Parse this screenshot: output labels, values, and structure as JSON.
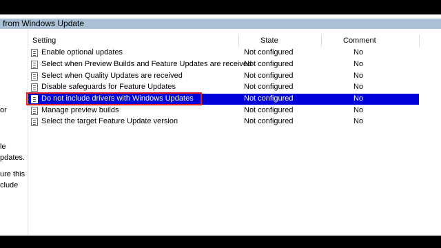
{
  "breadcrumb": {
    "text": "from Windows Update"
  },
  "left_pane": {
    "lines": [
      "or",
      "le",
      "pdates.",
      "ure this",
      "clude",
      ""
    ]
  },
  "columns": {
    "setting": "Setting",
    "state": "State",
    "comment": "Comment"
  },
  "rows": [
    {
      "name": "Enable optional updates",
      "state": "Not configured",
      "comment": "No"
    },
    {
      "name": "Select when Preview Builds and Feature Updates are received",
      "state": "Not configured",
      "comment": "No"
    },
    {
      "name": "Select when Quality Updates are received",
      "state": "Not configured",
      "comment": "No"
    },
    {
      "name": "Disable safeguards for Feature Updates",
      "state": "Not configured",
      "comment": "No"
    },
    {
      "name": "Do not include drivers with Windows Updates",
      "state": "Not configured",
      "comment": "No",
      "selected": true
    },
    {
      "name": "Manage preview builds",
      "state": "Not configured",
      "comment": "No"
    },
    {
      "name": "Select the target Feature Update version",
      "state": "Not configured",
      "comment": "No"
    }
  ],
  "colors": {
    "selection": "#0000d8",
    "annotation_box": "#e02020",
    "breadcrumb_bg": "#a9c0d6"
  }
}
